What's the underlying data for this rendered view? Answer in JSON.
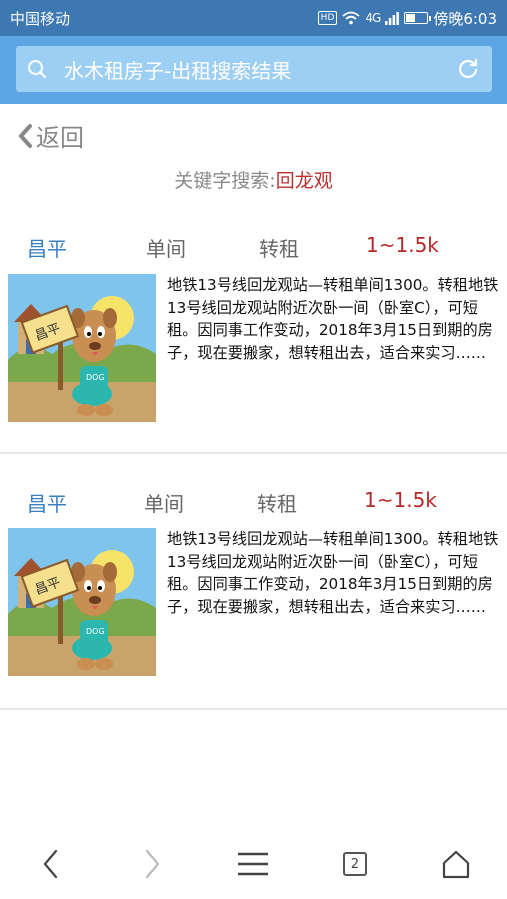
{
  "status_bar": {
    "carrier": "中国移动",
    "network": "4G",
    "time": "傍晚6:03",
    "battery_level": 0.45
  },
  "search": {
    "query": "水木租房子-出租搜索结果"
  },
  "nav": {
    "back_label": "返回"
  },
  "keyword": {
    "prefix": "关键字搜索:",
    "value": "回龙观"
  },
  "listings": [
    {
      "area": "昌平",
      "room_type": "单间",
      "rent_type": "转租",
      "price": "1~1.5k",
      "sign_text": "昌平",
      "shirt_text": "DOG",
      "description": "地铁13号线回龙观站—转租单间1300。转租地铁13号线回龙观站附近次卧一间（卧室C），可短租。因同事工作变动，2018年3月15日到期的房子，现在要搬家，想转租出去，适合来实习……"
    },
    {
      "area": "昌平",
      "room_type": "单间",
      "rent_type": "转租",
      "price": "1~1.5k",
      "sign_text": "昌平",
      "shirt_text": "DOG",
      "description": "地铁13号线回龙观站—转租单间1300。转租地铁13号线回龙观站附近次卧一间（卧室C），可短租。因同事工作变动，2018年3月15日到期的房子，现在要搬家，想转租出去，适合来实习……"
    }
  ],
  "bottom_bar": {
    "tab_count": "2"
  },
  "colors": {
    "status_bar": "#3e78b2",
    "search_header": "#5ba6e2",
    "area_tag": "#3a7fc0",
    "price_tag": "#b42a2a",
    "keyword_value": "#b83232"
  }
}
